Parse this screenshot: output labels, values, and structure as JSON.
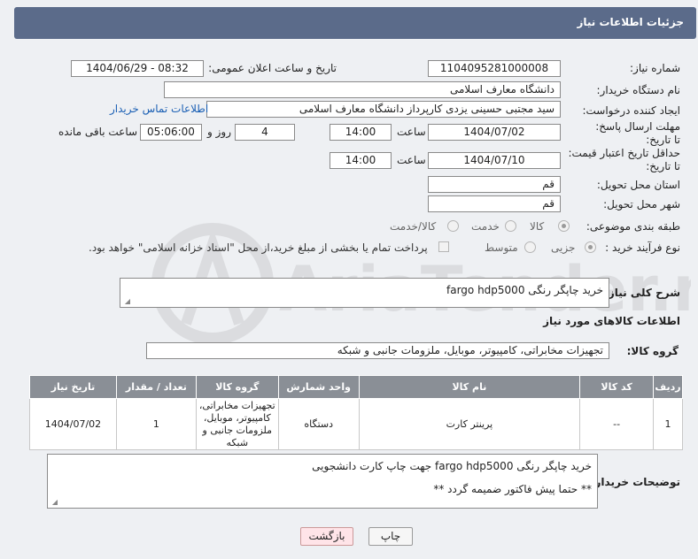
{
  "header": {
    "title": "جزئیات اطلاعات نیاز"
  },
  "fields": {
    "need_number_label": "شماره نیاز:",
    "need_number": "1104095281000008",
    "announce_label": "تاریخ و ساعت اعلان عمومی:",
    "announce_value": "1404/06/29 - 08:32",
    "buyer_org_label": "نام دستگاه خریدار:",
    "buyer_org": "دانشگاه معارف اسلامی",
    "requester_label": "ایجاد کننده درخواست:",
    "requester": "سید مجتبی حسینی یزدی کارپرداز دانشگاه معارف اسلامی",
    "contact_link": "اطلاعات تماس خریدار",
    "deadline_label": "مهلت ارسال پاسخ: تا تاریخ:",
    "deadline_date": "1404/07/02",
    "time_label": "ساعت",
    "deadline_time": "14:00",
    "days_value": "4",
    "days_label": "روز و",
    "remaining_time": "05:06:00",
    "remaining_label": "ساعت باقی مانده",
    "validity_label": "حداقل تاریخ اعتبار قیمت: تا تاریخ:",
    "validity_date": "1404/07/10",
    "validity_time": "14:00",
    "province_label": "استان محل تحویل:",
    "province": "قم",
    "city_label": "شهر محل تحویل:",
    "city": "قم",
    "category_label": "طبقه بندی موضوعی:",
    "category_options": [
      "کالا",
      "خدمت",
      "کالا/خدمت"
    ],
    "process_label": "نوع فرآیند خرید :",
    "process_options": [
      "جزیی",
      "متوسط"
    ],
    "payment_note": "پرداخت تمام یا بخشی از مبلغ خرید،از محل \"اسناد خزانه اسلامی\" خواهد بود."
  },
  "description": {
    "label": "شرح کلی نیاز:",
    "text": "خرید چاپگر رنگی  fargo  hdp5000"
  },
  "goods_section": {
    "title": "اطلاعات کالاهای مورد نیاز",
    "group_label": "گروه کالا:",
    "group_value": "تجهیزات مخابراتی، کامپیوتر، موبایل، ملزومات جانبی و شبکه"
  },
  "table": {
    "headers": [
      "ردیف",
      "کد کالا",
      "نام کالا",
      "واحد شمارش",
      "گروه کالا",
      "تعداد / مقدار",
      "تاریخ نیاز"
    ],
    "rows": [
      {
        "row": "1",
        "code": "--",
        "name": "پرینتر کارت",
        "unit": "دستگاه",
        "group": "تجهیزات مخابراتی، کامپیوتر، موبایل، ملزومات جانبی و شبکه",
        "qty": "1",
        "date": "1404/07/02"
      }
    ]
  },
  "buyer_notes": {
    "label": "توضیحات خریدار:",
    "line1": "خرید چاپگر رنگی  fargo  hdp5000  جهت چاپ کارت دانشجویی",
    "line2": "** حتما پیش فاکتور ضمیمه گردد **"
  },
  "buttons": {
    "print": "چاپ",
    "back": "بازگشت"
  },
  "watermark": {
    "text": "AriaTender.net"
  }
}
